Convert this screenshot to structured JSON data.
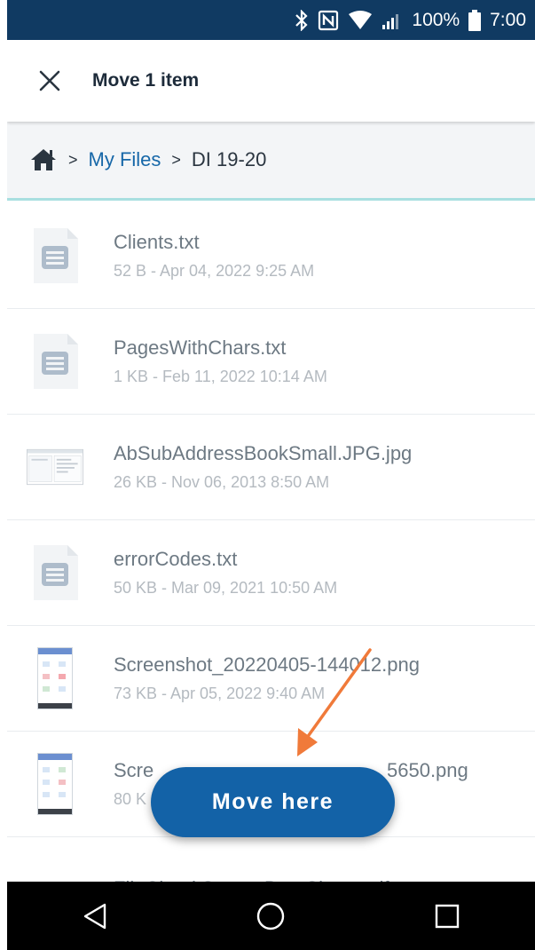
{
  "status_bar": {
    "battery": "100%",
    "time": "7:00",
    "icons": [
      "bluetooth-icon",
      "nfc-icon",
      "wifi-icon",
      "signal-icon",
      "battery-icon"
    ]
  },
  "header": {
    "title": "Move 1 item",
    "close_icon": "close-icon"
  },
  "breadcrumb": {
    "home_icon": "home-icon",
    "separator": ">",
    "items": [
      "My Files",
      "DI 19-20"
    ]
  },
  "files": [
    {
      "name": "Clients.txt",
      "detail": "52 B - Apr 04, 2022 9:25 AM",
      "icon": "text-file-icon"
    },
    {
      "name": "PagesWithChars.txt",
      "detail": "1 KB - Feb 11, 2022 10:14 AM",
      "icon": "text-file-icon"
    },
    {
      "name": "AbSubAddressBookSmall.JPG.jpg",
      "detail": "26 KB - Nov 06, 2013 8:50 AM",
      "icon": "image-thumbnail"
    },
    {
      "name": "errorCodes.txt",
      "detail": "50 KB - Mar 09, 2021 10:50 AM",
      "icon": "text-file-icon"
    },
    {
      "name": "Screenshot_20220405-144012.png",
      "detail": "73 KB - Apr 05, 2022 9:40 AM",
      "icon": "phone-screenshot-thumbnail"
    },
    {
      "name": "Scre",
      "name_end": "5650.png",
      "detail": "80 K",
      "icon": "phone-screenshot-thumbnail"
    },
    {
      "name": "FileCloud Server DataSheet.pdf",
      "icon": "pdf-file-icon"
    }
  ],
  "move_button": {
    "label": "Move here"
  },
  "colors": {
    "status_bar": "#103a62",
    "accent": "#1362a7",
    "link": "#1667a8",
    "arrow": "#f07a3a",
    "divider_accent": "#a8dfe0"
  },
  "nav_bar": {
    "icons": [
      "back-icon",
      "home-circle-icon",
      "recents-icon"
    ]
  }
}
